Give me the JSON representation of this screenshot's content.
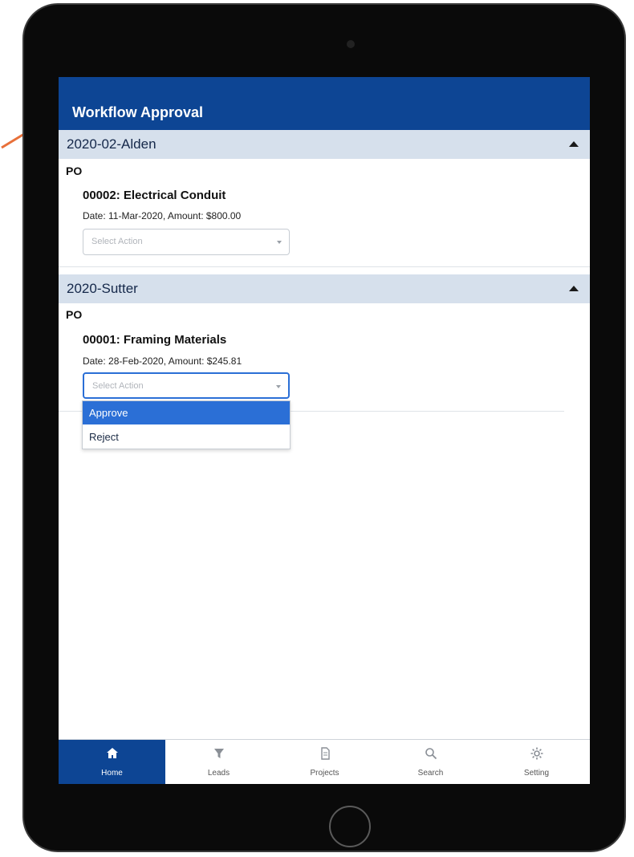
{
  "header": {
    "title": "Workflow Approval"
  },
  "groups": [
    {
      "name": "2020-02-Alden",
      "type": "PO",
      "item": {
        "title": "00002: Electrical Conduit",
        "meta": "Date: 11-Mar-2020, Amount: $800.00",
        "select_placeholder": "Select Action"
      }
    },
    {
      "name": "2020-Sutter",
      "type": "PO",
      "item": {
        "title": "00001: Framing Materials",
        "meta": "Date: 28-Feb-2020, Amount: $245.81",
        "select_placeholder": "Select Action"
      }
    }
  ],
  "dropdown": {
    "options": [
      "Approve",
      "Reject"
    ],
    "highlighted": "Approve"
  },
  "tabs": [
    {
      "label": "Home",
      "icon": "home-icon",
      "active": true
    },
    {
      "label": "Leads",
      "icon": "funnel-icon",
      "active": false
    },
    {
      "label": "Projects",
      "icon": "document-icon",
      "active": false
    },
    {
      "label": "Search",
      "icon": "search-icon",
      "active": false
    },
    {
      "label": "Setting",
      "icon": "gear-icon",
      "active": false
    }
  ],
  "colors": {
    "brand": "#0d4594",
    "group_bar": "#d6e0ec",
    "selected_option": "#2b6fd6",
    "annotation_arrow": "#e8703a"
  }
}
